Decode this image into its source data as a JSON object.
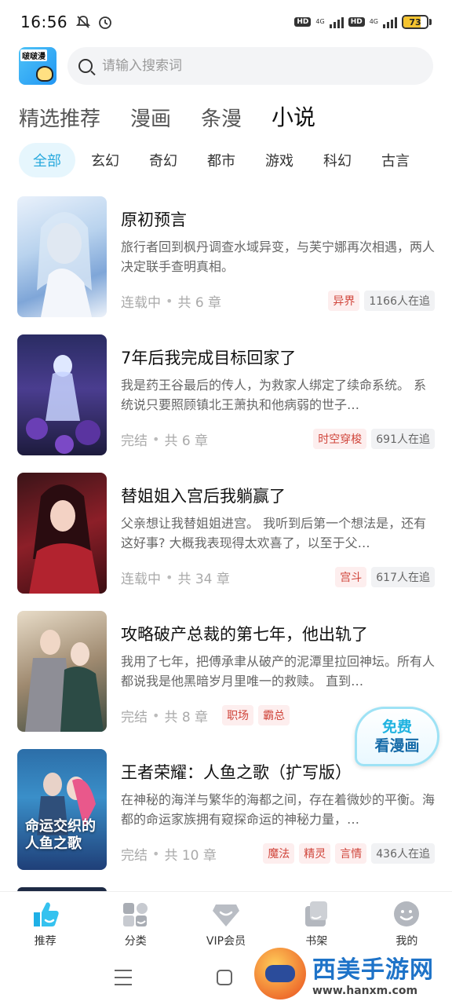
{
  "status_bar": {
    "time": "16:56",
    "hd1": "HD",
    "net1": "4G",
    "hd2": "HD",
    "net2": "4G",
    "battery": "73",
    "battery_level": 0.73
  },
  "search": {
    "placeholder": "请输入搜索词"
  },
  "main_tabs": [
    {
      "label": "精选推荐",
      "active": false
    },
    {
      "label": "漫画",
      "active": false
    },
    {
      "label": "条漫",
      "active": false
    },
    {
      "label": "小说",
      "active": true
    }
  ],
  "categories": [
    {
      "label": "全部",
      "active": true
    },
    {
      "label": "玄幻",
      "active": false
    },
    {
      "label": "奇幻",
      "active": false
    },
    {
      "label": "都市",
      "active": false
    },
    {
      "label": "游戏",
      "active": false
    },
    {
      "label": "科幻",
      "active": false
    },
    {
      "label": "古言",
      "active": false
    }
  ],
  "books": [
    {
      "title": "原初预言",
      "desc": "旅行者回到枫丹调查水域异变，与芙宁娜再次相遇，两人决定联手查明真相。",
      "status": "连载中",
      "chapters": "共 6 章",
      "tags": [
        "异界"
      ],
      "readers": "1166人在追"
    },
    {
      "title": "7年后我完成目标回家了",
      "desc": "我是药王谷最后的传人，为救家人绑定了续命系统。 系统说只要照顾镇北王萧执和他病弱的世子…",
      "status": "完结",
      "chapters": "共 6 章",
      "tags": [
        "时空穿梭"
      ],
      "readers": "691人在追"
    },
    {
      "title": "替姐姐入宫后我躺赢了",
      "desc": "父亲想让我替姐姐进宫。 我听到后第一个想法是，还有这好事? 大概我表现得太欢喜了，以至于父…",
      "status": "连载中",
      "chapters": "共 34 章",
      "tags": [
        "宫斗"
      ],
      "readers": "617人在追"
    },
    {
      "title": "攻略破产总裁的第七年，他出轨了",
      "desc": "我用了七年，把傅承聿从破产的泥潭里拉回神坛。所有人都说我是他黑暗岁月里唯一的救赎。 直到…",
      "status": "完结",
      "chapters": "共 8 章",
      "tags": [
        "职场",
        "霸总"
      ],
      "readers": ""
    },
    {
      "title": "王者荣耀：人鱼之歌（扩写版）",
      "desc": "在神秘的海洋与繁华的海都之间，存在着微妙的平衡。海都的命运家族拥有窥探命运的神秘力量，…",
      "status": "完结",
      "chapters": "共 10 章",
      "tags": [
        "魔法",
        "精灵",
        "言情"
      ],
      "readers": "436人在追",
      "cover_title": "命运交织的\n人鱼之歌"
    }
  ],
  "float_button": {
    "line1": "免费",
    "line2": "看漫画"
  },
  "bottom_nav": [
    {
      "label": "推荐",
      "active": true
    },
    {
      "label": "分类",
      "active": false
    },
    {
      "label": "VIP会员",
      "active": false
    },
    {
      "label": "书架",
      "active": false
    },
    {
      "label": "我的",
      "active": false
    }
  ],
  "logo": {
    "text": "啵啵漫"
  },
  "watermark": {
    "title": "西美手游网",
    "url": "www.hanxm.com"
  },
  "colors": {
    "accent": "#29a9dd",
    "tag_text": "#d0453b",
    "tag_bg": "#fdeeee"
  }
}
